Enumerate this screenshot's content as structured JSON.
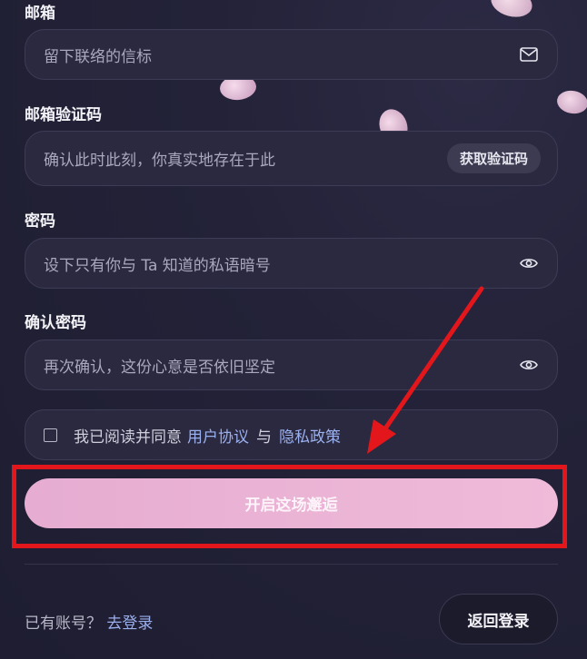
{
  "form": {
    "email_label": "邮箱",
    "email_placeholder": "留下联络的信标",
    "code_label": "邮箱验证码",
    "code_placeholder": "确认此时此刻，你真实地存在于此",
    "code_button": "获取验证码",
    "password_label": "密码",
    "password_placeholder": "设下只有你与 Ta 知道的私语暗号",
    "confirm_label": "确认密码",
    "confirm_placeholder": "再次确认，这份心意是否依旧坚定"
  },
  "agreement": {
    "prefix": "我已阅读并同意",
    "user_agreement": "用户协议",
    "and": "与",
    "privacy_policy": "隐私政策",
    "checked": false
  },
  "submit_label": "开启这场邂逅",
  "footer": {
    "have_account": "已有账号？",
    "login_link": "去登录",
    "back_button": "返回登录"
  },
  "colors": {
    "accent_pink": "#e6acd1",
    "link_blue": "#9bb0ee",
    "highlight_red": "#e3171b"
  }
}
